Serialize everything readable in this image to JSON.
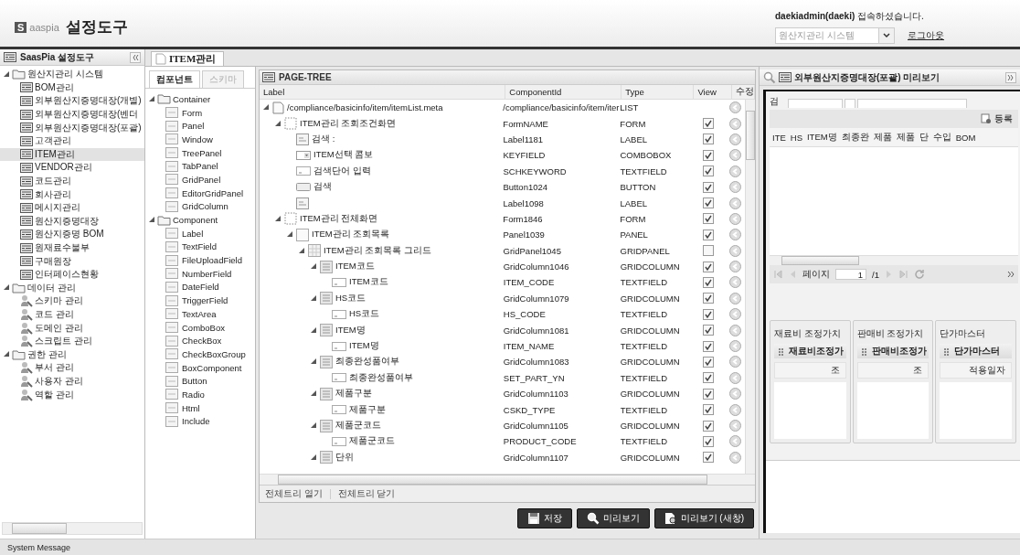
{
  "header": {
    "logo_mark": "S",
    "logo_text": "aaspia",
    "title": "설정도구",
    "greeting": "**daekiadmin(daeki)** 접속하셨습니다.",
    "system_select": "원산지관리 시스템",
    "logout": "로그아웃"
  },
  "sidebar": {
    "title": "SaasPia 설정도구",
    "groups": [
      {
        "label": "원산지관리 시스템",
        "expanded": true,
        "items": [
          {
            "label": "BOM관리",
            "kind": "page",
            "selected": false
          },
          {
            "label": "외부원산지증명대장(개별)",
            "kind": "page",
            "selected": false
          },
          {
            "label": "외부원산지증명대장(벤더",
            "kind": "page",
            "selected": false
          },
          {
            "label": "외부원산지증명대장(포괄)",
            "kind": "page",
            "selected": false
          },
          {
            "label": "고객관리",
            "kind": "page",
            "selected": false
          },
          {
            "label": "ITEM관리",
            "kind": "page",
            "selected": true
          },
          {
            "label": "VENDOR관리",
            "kind": "page",
            "selected": false
          },
          {
            "label": "코드관리",
            "kind": "page",
            "selected": false
          },
          {
            "label": "회사관리",
            "kind": "page",
            "selected": false
          },
          {
            "label": "메시지관리",
            "kind": "page",
            "selected": false
          },
          {
            "label": "원산지증명대장",
            "kind": "page",
            "selected": false
          },
          {
            "label": "원산지증명 BOM",
            "kind": "page",
            "selected": false
          },
          {
            "label": "원재료수불부",
            "kind": "page",
            "selected": false
          },
          {
            "label": "구매원장",
            "kind": "page",
            "selected": false
          },
          {
            "label": "인터페이스현황",
            "kind": "page",
            "selected": false
          }
        ]
      },
      {
        "label": "데이터 관리",
        "expanded": true,
        "items": [
          {
            "label": "스키마 관리",
            "kind": "tool",
            "selected": false
          },
          {
            "label": "코드 관리",
            "kind": "tool",
            "selected": false
          },
          {
            "label": "도메인 관리",
            "kind": "tool",
            "selected": false
          },
          {
            "label": "스크립트 관리",
            "kind": "tool",
            "selected": false
          }
        ]
      },
      {
        "label": "권한 관리",
        "expanded": true,
        "items": [
          {
            "label": "부서 관리",
            "kind": "tool",
            "selected": false
          },
          {
            "label": "사용자 관리",
            "kind": "tool",
            "selected": false
          },
          {
            "label": "역할 관리",
            "kind": "tool",
            "selected": false
          }
        ]
      }
    ]
  },
  "tabs": [
    {
      "label": "ITEM관리",
      "selected": true
    }
  ],
  "palette": {
    "tabs": [
      {
        "label": "컴포넌트",
        "selected": true
      },
      {
        "label": "스키마",
        "selected": false
      }
    ],
    "groups": [
      {
        "label": "Container",
        "expanded": true,
        "items": [
          "Form",
          "Panel",
          "Window",
          "TreePanel",
          "TabPanel",
          "GridPanel",
          "EditorGridPanel",
          "GridColumn"
        ]
      },
      {
        "label": "Component",
        "expanded": true,
        "items": [
          "Label",
          "TextField",
          "FileUploadField",
          "NumberField",
          "DateField",
          "TriggerField",
          "TextArea",
          "ComboBox",
          "CheckBox",
          "CheckBoxGroup",
          "BoxComponent",
          "Button",
          "Radio",
          "Html",
          "Include"
        ]
      }
    ]
  },
  "page_tree": {
    "title": "PAGE-TREE",
    "columns": [
      "Label",
      "ComponentId",
      "Type",
      "View",
      "수정"
    ],
    "rows": [
      {
        "kind": "file",
        "label": "/compliance/basicinfo/item/itemList.meta",
        "id": "/compliance/basicinfo/item/iter",
        "type": "LIST",
        "expanded": true,
        "children": [
          {
            "kind": "form",
            "label": "ITEM관리 조회조건화면",
            "id": "FormNAME",
            "type": "FORM",
            "view": true,
            "expanded": true,
            "children": [
              {
                "kind": "label",
                "label": "검색 :",
                "id": "Label1181",
                "type": "LABEL",
                "view": true
              },
              {
                "kind": "combo",
                "label": "ITEM선택 콤보",
                "id": "KEYFIELD",
                "type": "COMBOBOX",
                "view": true
              },
              {
                "kind": "text",
                "label": "검색단어 입력",
                "id": "SCHKEYWORD",
                "type": "TEXTFIELD",
                "view": true
              },
              {
                "kind": "button",
                "label": "검색",
                "id": "Button1024",
                "type": "BUTTON",
                "view": true
              },
              {
                "kind": "label",
                "id": "Label1098",
                "type": "LABEL",
                "view": true
              }
            ]
          },
          {
            "kind": "form",
            "label": "ITEM관리 전체화면",
            "id": "Form1846",
            "type": "FORM",
            "view": true,
            "expanded": true,
            "children": [
              {
                "kind": "panel",
                "label": "ITEM관리 조회목록",
                "id": "Panel1039",
                "type": "PANEL",
                "view": true,
                "expanded": true,
                "children": [
                  {
                    "kind": "grid",
                    "label": "ITEM관리 조회목록 그리드",
                    "id": "GridPanel1045",
                    "type": "GRIDPANEL",
                    "view": false,
                    "expanded": true,
                    "children": [
                      {
                        "kind": "column",
                        "label": "ITEM코드",
                        "id": "GridColumn1046",
                        "type": "GRIDCOLUMN",
                        "view": true,
                        "expanded": true,
                        "children": [
                          {
                            "kind": "text",
                            "label": "ITEM코드",
                            "id": "ITEM_CODE",
                            "type": "TEXTFIELD",
                            "view": true
                          }
                        ]
                      },
                      {
                        "kind": "column",
                        "label": "HS코드",
                        "id": "GridColumn1079",
                        "type": "GRIDCOLUMN",
                        "view": true,
                        "expanded": true,
                        "children": [
                          {
                            "kind": "text",
                            "label": "HS코드",
                            "id": "HS_CODE",
                            "type": "TEXTFIELD",
                            "view": true
                          }
                        ]
                      },
                      {
                        "kind": "column",
                        "label": "ITEM명",
                        "id": "GridColumn1081",
                        "type": "GRIDCOLUMN",
                        "view": true,
                        "expanded": true,
                        "children": [
                          {
                            "kind": "text",
                            "label": "ITEM명",
                            "id": "ITEM_NAME",
                            "type": "TEXTFIELD",
                            "view": true
                          }
                        ]
                      },
                      {
                        "kind": "column",
                        "label": "최종완성품여부",
                        "id": "GridColumn1083",
                        "type": "GRIDCOLUMN",
                        "view": true,
                        "expanded": true,
                        "children": [
                          {
                            "kind": "text",
                            "label": "최종완성품여부",
                            "id": "SET_PART_YN",
                            "type": "TEXTFIELD",
                            "view": true
                          }
                        ]
                      },
                      {
                        "kind": "column",
                        "label": "제품구분",
                        "id": "GridColumn1103",
                        "type": "GRIDCOLUMN",
                        "view": true,
                        "expanded": true,
                        "children": [
                          {
                            "kind": "text",
                            "label": "제품구분",
                            "id": "CSKD_TYPE",
                            "type": "TEXTFIELD",
                            "view": true
                          }
                        ]
                      },
                      {
                        "kind": "column",
                        "label": "제품군코드",
                        "id": "GridColumn1105",
                        "type": "GRIDCOLUMN",
                        "view": true,
                        "expanded": true,
                        "children": [
                          {
                            "kind": "text",
                            "label": "제품군코드",
                            "id": "PRODUCT_CODE",
                            "type": "TEXTFIELD",
                            "view": true
                          }
                        ]
                      },
                      {
                        "kind": "column",
                        "label": "단위",
                        "id": "GridColumn1107",
                        "type": "GRIDCOLUMN",
                        "view": true,
                        "expanded": true
                      }
                    ]
                  }
                ]
              }
            ]
          }
        ]
      }
    ],
    "footer": [
      "전체트리 열기",
      "전체트리 닫기"
    ],
    "buttons": [
      {
        "label": "저장",
        "kind": "save"
      },
      {
        "label": "미리보기",
        "kind": "preview"
      },
      {
        "label": "미리보기 (새창)",
        "kind": "new_window"
      }
    ]
  },
  "preview": {
    "title": "외부원산지증명대장(포괄) 미리보기",
    "search_label": "검",
    "add_button": "등록",
    "grid_columns": [
      "ITE",
      "HS",
      "ITEM명",
      "최종완",
      "제품",
      "제품",
      "단",
      "수입",
      "BOM"
    ],
    "pager": {
      "label": "페이지",
      "page": "1",
      "total": "/1"
    },
    "panels": [
      {
        "title": "재료비 조정가치",
        "grid_title": "재료비조정가",
        "column": "조"
      },
      {
        "title": "판매비 조정가치",
        "grid_title": "판매비조정가",
        "column": "조"
      },
      {
        "title": "단가마스터",
        "grid_title": "단가마스터",
        "column": "적용일자"
      }
    ]
  },
  "status_bar": "System Message"
}
